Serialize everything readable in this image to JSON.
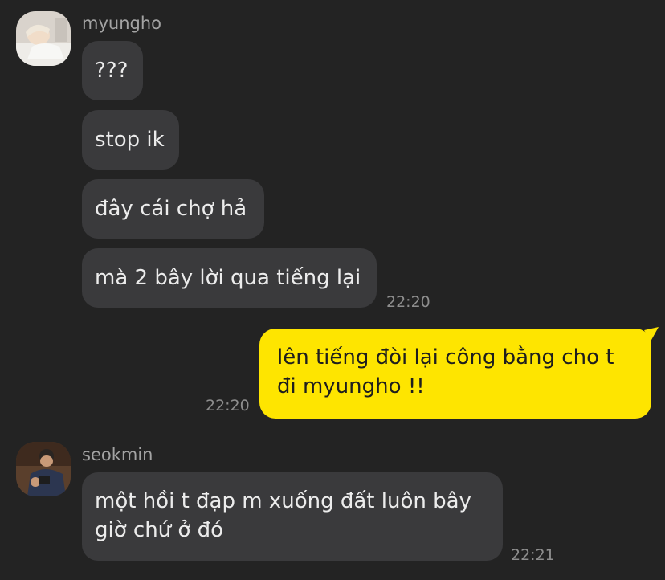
{
  "messages": [
    {
      "sender": "myungho",
      "avatar_icon": "avatar-photo-icon",
      "bubbles": [
        "???",
        "stop ik",
        "đây cái chợ hả",
        "mà 2 bây lời qua tiếng lại"
      ],
      "time": "22:20"
    },
    {
      "sender": "me",
      "bubble": "lên tiếng đòi lại công bằng cho t đi myungho !!",
      "time": "22:20"
    },
    {
      "sender": "seokmin",
      "avatar_icon": "avatar-photo-icon",
      "bubble": "một hồi t đạp m xuống đất luôn bây giờ chứ ở đó",
      "time": "22:21"
    }
  ],
  "colors": {
    "background": "#232323",
    "incoming_bubble": "#3a3a3c",
    "outgoing_bubble": "#fee500",
    "sender_name": "#a3a3a3",
    "timestamp": "#8e8e8e"
  }
}
